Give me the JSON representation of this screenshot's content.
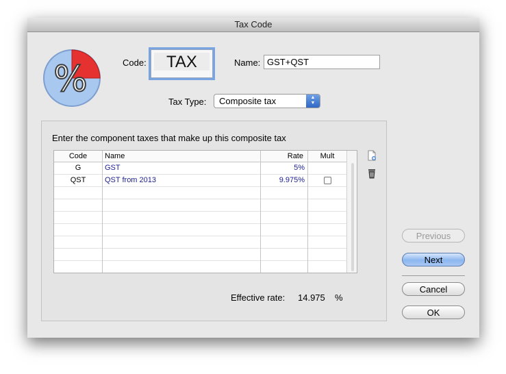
{
  "window": {
    "title": "Tax Code"
  },
  "form": {
    "code_label": "Code:",
    "code_value": "TAX",
    "name_label": "Name:",
    "name_value": "GST+QST",
    "tax_type_label": "Tax Type:",
    "tax_type_value": "Composite tax"
  },
  "group": {
    "instruction": "Enter the component taxes that make up this composite tax",
    "columns": {
      "code": "Code",
      "name": "Name",
      "rate": "Rate",
      "mult": "Mult"
    },
    "rows": [
      {
        "code": "G",
        "name": "GST",
        "rate": "5%",
        "mult": ""
      },
      {
        "code": "QST",
        "name": "QST from 2013",
        "rate": "9.975%",
        "mult": "unchecked"
      }
    ],
    "effective_label": "Effective rate:",
    "effective_value": "14.975",
    "effective_unit": "%"
  },
  "buttons": {
    "previous": "Previous",
    "next": "Next",
    "cancel": "Cancel",
    "ok": "OK"
  },
  "icons": {
    "logo": "percent-pie-icon",
    "add": "add-row-icon",
    "delete": "trash-icon"
  },
  "colors": {
    "accent_blue": "#2f67c4",
    "table_text_blue": "#1b1e8f",
    "pie_red": "#e63131",
    "pie_blue": "#a9c8f0"
  }
}
